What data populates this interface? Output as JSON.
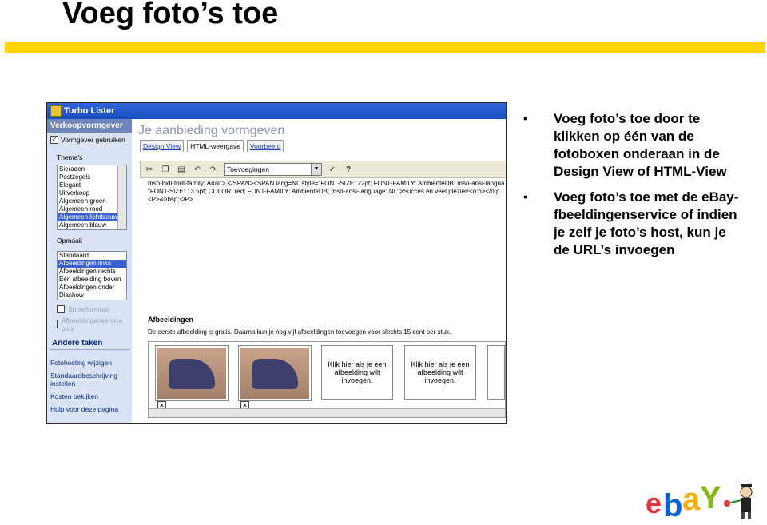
{
  "slide": {
    "title": "Voeg foto’s toe",
    "accent_color": "#ffd400"
  },
  "app": {
    "window_title": "Turbo Lister",
    "left_pane": {
      "header": "Verkoopvormgever",
      "use_designer_checkbox": "Vormgever gebruiken",
      "themes_label": "Thema's",
      "themes": [
        "Sieraden",
        "Postzegels",
        "Elegant",
        "Uitverkoop",
        "Algemeen groen",
        "Algemeen rood",
        "Algemeen lichtblauw",
        "Algemeen blauw"
      ],
      "themes_selected_index": 6,
      "layout_label": "Opmaak",
      "layouts": [
        "Standaard",
        "Afbeeldingen links",
        "Afbeeldingen rechts",
        "Eén afbeelding boven",
        "Afbeeldingen onder",
        "Diashow"
      ],
      "layouts_selected_index": 1,
      "option_superformaat": "Superformaat",
      "option_service": "Afbeeldingenservice plus",
      "other_tasks_header": "Andere taken",
      "links": [
        "Fotohosting wijzigen",
        "Standaardbeschrijving instellen",
        "Kosten bekijken",
        "Hulp voor deze pagina"
      ]
    },
    "right_pane": {
      "heading": "Je aanbieding vormgeven",
      "tabs": [
        "Design View",
        "HTML-weergave",
        "Voorbeeld"
      ],
      "active_tab_index": 1,
      "toolbar": {
        "insert_select_value": "Toevoegingen",
        "help_label": "?"
      },
      "code_lines": [
        "mso-bidi-font-family: Arial\"> </SPAN><SPAN lang=NL style=\"FONT-SIZE: 22pt; FONT-FAMILY: AmbienteDB; mso-ansi-langua",
        "\"FONT-SIZE: 13.5pt; COLOR: red; FONT-FAMILY: AmbienteDB; mso-ansi-language: NL\">Succes en veel plezier!<o:p></o:p",
        "<P>&nbsp;</P>"
      ],
      "images_title": "Afbeeldingen",
      "images_desc": "De eerste afbeelding is gratis. Daarna kun je nog vijf afbeeldingen toevoegen voor slechts 15 cent per stuk.",
      "placeholder_text": "Klik hier als je een afbeelding wilt invoegen."
    }
  },
  "bullets": [
    "Voeg foto’s toe door te klikken op één van de fotoboxen onderaan in de Design View of HTML-View",
    "Voeg foto’s toe met de eBay-fbeeldingenservice of indien je zelf je foto’s host, kun je de URL’s invoegen"
  ],
  "logo": {
    "text": "ebY",
    "icon": "ebay-logo-with-mascot"
  }
}
